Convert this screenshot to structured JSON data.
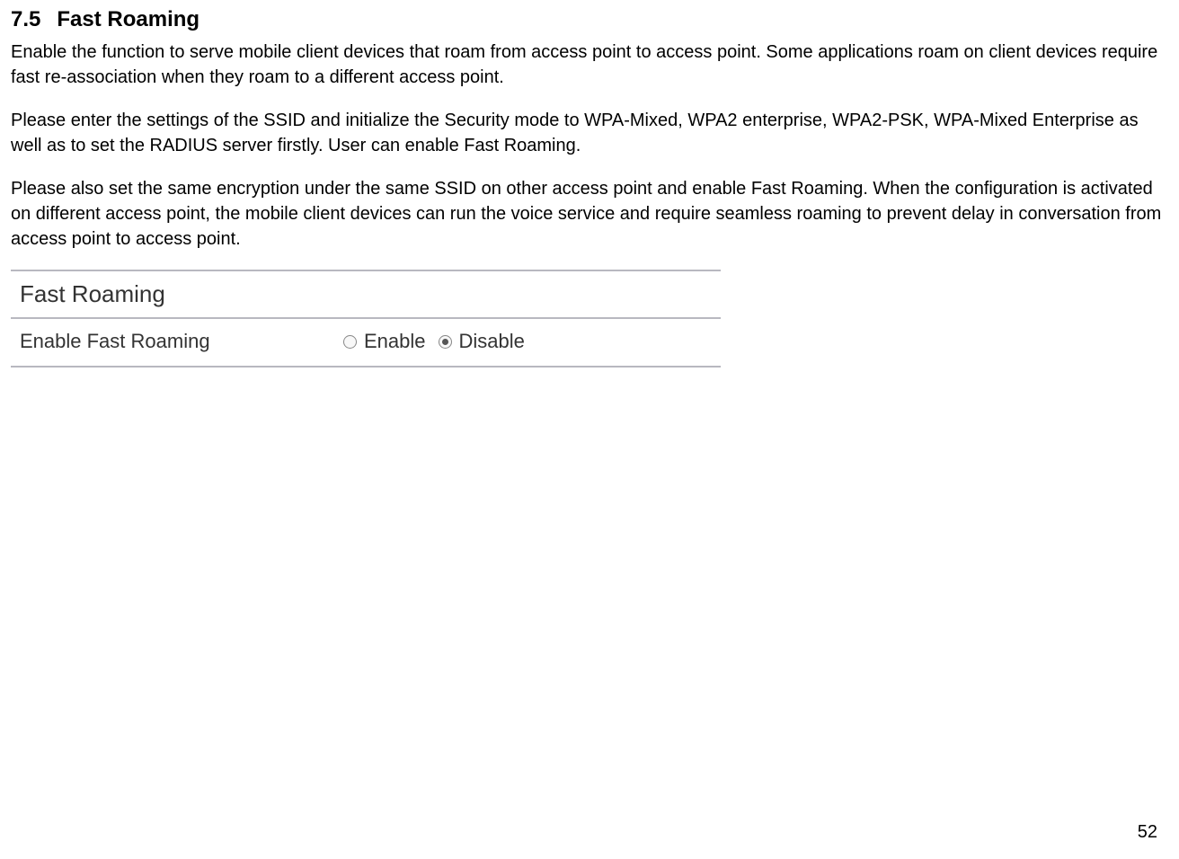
{
  "heading": {
    "number": "7.5",
    "title": "Fast Roaming"
  },
  "paragraphs": {
    "p1": "Enable the function to serve mobile client devices that roam from access point to access point. Some applications roam on client devices require fast re-association when they roam to a different access point.",
    "p2": "Please enter the settings of the SSID and initialize the Security mode to WPA-Mixed, WPA2 enterprise, WPA2-PSK, WPA-Mixed Enterprise as well as to set the RADIUS server firstly. User can enable Fast Roaming.",
    "p3": "Please also set the same encryption under the same SSID on other access point and enable Fast Roaming. When the configuration is activated on different access point, the mobile client devices can run the voice service and require seamless roaming to prevent delay in conversation from access point to access point."
  },
  "panel": {
    "title": "Fast Roaming",
    "row_label": "Enable Fast Roaming",
    "option_enable": "Enable",
    "option_disable": "Disable",
    "selected": "disable"
  },
  "page_number": "52"
}
